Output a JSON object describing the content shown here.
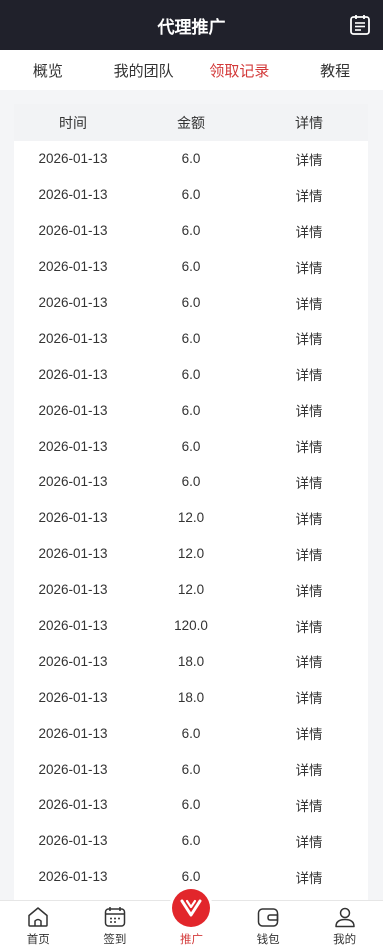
{
  "header": {
    "title": "代理推广"
  },
  "tabs": [
    {
      "label": "概览"
    },
    {
      "label": "我的团队"
    },
    {
      "label": "领取记录"
    },
    {
      "label": "教程"
    }
  ],
  "active_tab": "领取记录",
  "table": {
    "columns": [
      "时间",
      "金额",
      "详情"
    ],
    "rows": [
      [
        "2026-01-13",
        "6.0",
        "详情"
      ],
      [
        "2026-01-13",
        "6.0",
        "详情"
      ],
      [
        "2026-01-13",
        "6.0",
        "详情"
      ],
      [
        "2026-01-13",
        "6.0",
        "详情"
      ],
      [
        "2026-01-13",
        "6.0",
        "详情"
      ],
      [
        "2026-01-13",
        "6.0",
        "详情"
      ],
      [
        "2026-01-13",
        "6.0",
        "详情"
      ],
      [
        "2026-01-13",
        "6.0",
        "详情"
      ],
      [
        "2026-01-13",
        "6.0",
        "详情"
      ],
      [
        "2026-01-13",
        "6.0",
        "详情"
      ],
      [
        "2026-01-13",
        "12.0",
        "详情"
      ],
      [
        "2026-01-13",
        "12.0",
        "详情"
      ],
      [
        "2026-01-13",
        "12.0",
        "详情"
      ],
      [
        "2026-01-13",
        "120.0",
        "详情"
      ],
      [
        "2026-01-13",
        "18.0",
        "详情"
      ],
      [
        "2026-01-13",
        "18.0",
        "详情"
      ],
      [
        "2026-01-13",
        "6.0",
        "详情"
      ],
      [
        "2026-01-13",
        "6.0",
        "详情"
      ],
      [
        "2026-01-13",
        "6.0",
        "详情"
      ],
      [
        "2026-01-13",
        "6.0",
        "详情"
      ],
      [
        "2026-01-13",
        "6.0",
        "详情"
      ]
    ]
  },
  "bottom_nav": [
    {
      "label": "首页",
      "icon": "home-icon"
    },
    {
      "label": "签到",
      "icon": "calendar-icon"
    },
    {
      "label": "推广",
      "icon": "promote-icon"
    },
    {
      "label": "钱包",
      "icon": "wallet-icon"
    },
    {
      "label": "我的",
      "icon": "user-icon"
    }
  ],
  "colors": {
    "header_bg": "#20212b",
    "accent": "#d33a3a",
    "promo": "#e2262b"
  }
}
